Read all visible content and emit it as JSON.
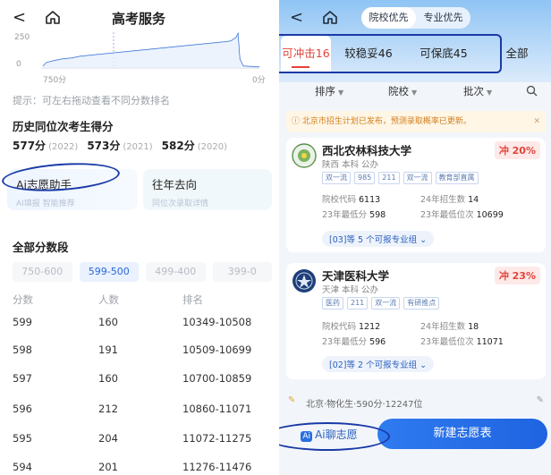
{
  "left": {
    "back_label": "<",
    "title": "高考服务",
    "mini_chart": {
      "y_tick_top": "250",
      "y_tick_bottom": "0",
      "x_label_left": "750分",
      "x_label_right": "0分"
    },
    "hint": "提示：可左右拖动查看不同分数排名",
    "history_title": "历史同位次考生得分",
    "history": [
      {
        "score": "577分",
        "year": "(2022)"
      },
      {
        "score": "573分",
        "year": "(2021)"
      },
      {
        "score": "582分",
        "year": "(2020)"
      }
    ],
    "cards": [
      {
        "title": "Ai志愿助手",
        "sub": "AI填报 智能推荐"
      },
      {
        "title": "往年去向",
        "sub": "同位次录取详情"
      }
    ],
    "all_title": "全部分数段",
    "ranges": [
      "750-600",
      "599-500",
      "499-400",
      "399-0"
    ],
    "table_headers": [
      "分数",
      "人数",
      "排名"
    ],
    "rows": [
      {
        "score": "599",
        "count": "160",
        "rank": "10349-10508"
      },
      {
        "score": "598",
        "count": "191",
        "rank": "10509-10699"
      },
      {
        "score": "597",
        "count": "160",
        "rank": "10700-10859"
      },
      {
        "score": "596",
        "count": "212",
        "rank": "10860-11071"
      },
      {
        "score": "595",
        "count": "204",
        "rank": "11072-11275"
      },
      {
        "score": "594",
        "count": "201",
        "rank": "11276-11476"
      }
    ]
  },
  "right": {
    "back_label": "<",
    "seg": [
      "院校优先",
      "专业优先"
    ],
    "strategy_tabs": [
      "可冲击16",
      "较稳妥46",
      "可保底45",
      "全部"
    ],
    "filters": [
      "排序",
      "院校",
      "批次"
    ],
    "notice": "北京市招生计划已发布，预测录取概率已更新。",
    "schools": [
      {
        "name": "西北农林科技大学",
        "meta": "陕西 本科 公办",
        "rate": "冲 20%",
        "tags": [
          "双一流",
          "985",
          "211",
          "双一流",
          "教育部直属"
        ],
        "code_label": "院校代码",
        "code": "6113",
        "plan_label": "24年招生数",
        "plan": "14",
        "min_label": "23年最低分",
        "min": "598",
        "rank_label": "23年最低位次",
        "rank": "10699",
        "group": "[03]等 5 个可报专业组 ⌄"
      },
      {
        "name": "天津医科大学",
        "meta": "天津 本科 公办",
        "rate": "冲 23%",
        "tags": [
          "医药",
          "211",
          "双一流",
          "有研推点"
        ],
        "code_label": "院校代码",
        "code": "1212",
        "plan_label": "24年招生数",
        "plan": "18",
        "min_label": "23年最低分",
        "min": "596",
        "rank_label": "23年最低位次",
        "rank": "11071",
        "group": "[02]等 2 个可报专业组 ⌄"
      }
    ],
    "location": "北京·物化生·590分·12247位",
    "ai_button": "Ai聊志愿",
    "ai_badge": "Ai",
    "new_button": "新建志愿表"
  },
  "colors": {
    "accent_blue": "#2f7bf0",
    "danger_red": "#e2443a",
    "annotation_navy": "#1a3aa6"
  }
}
